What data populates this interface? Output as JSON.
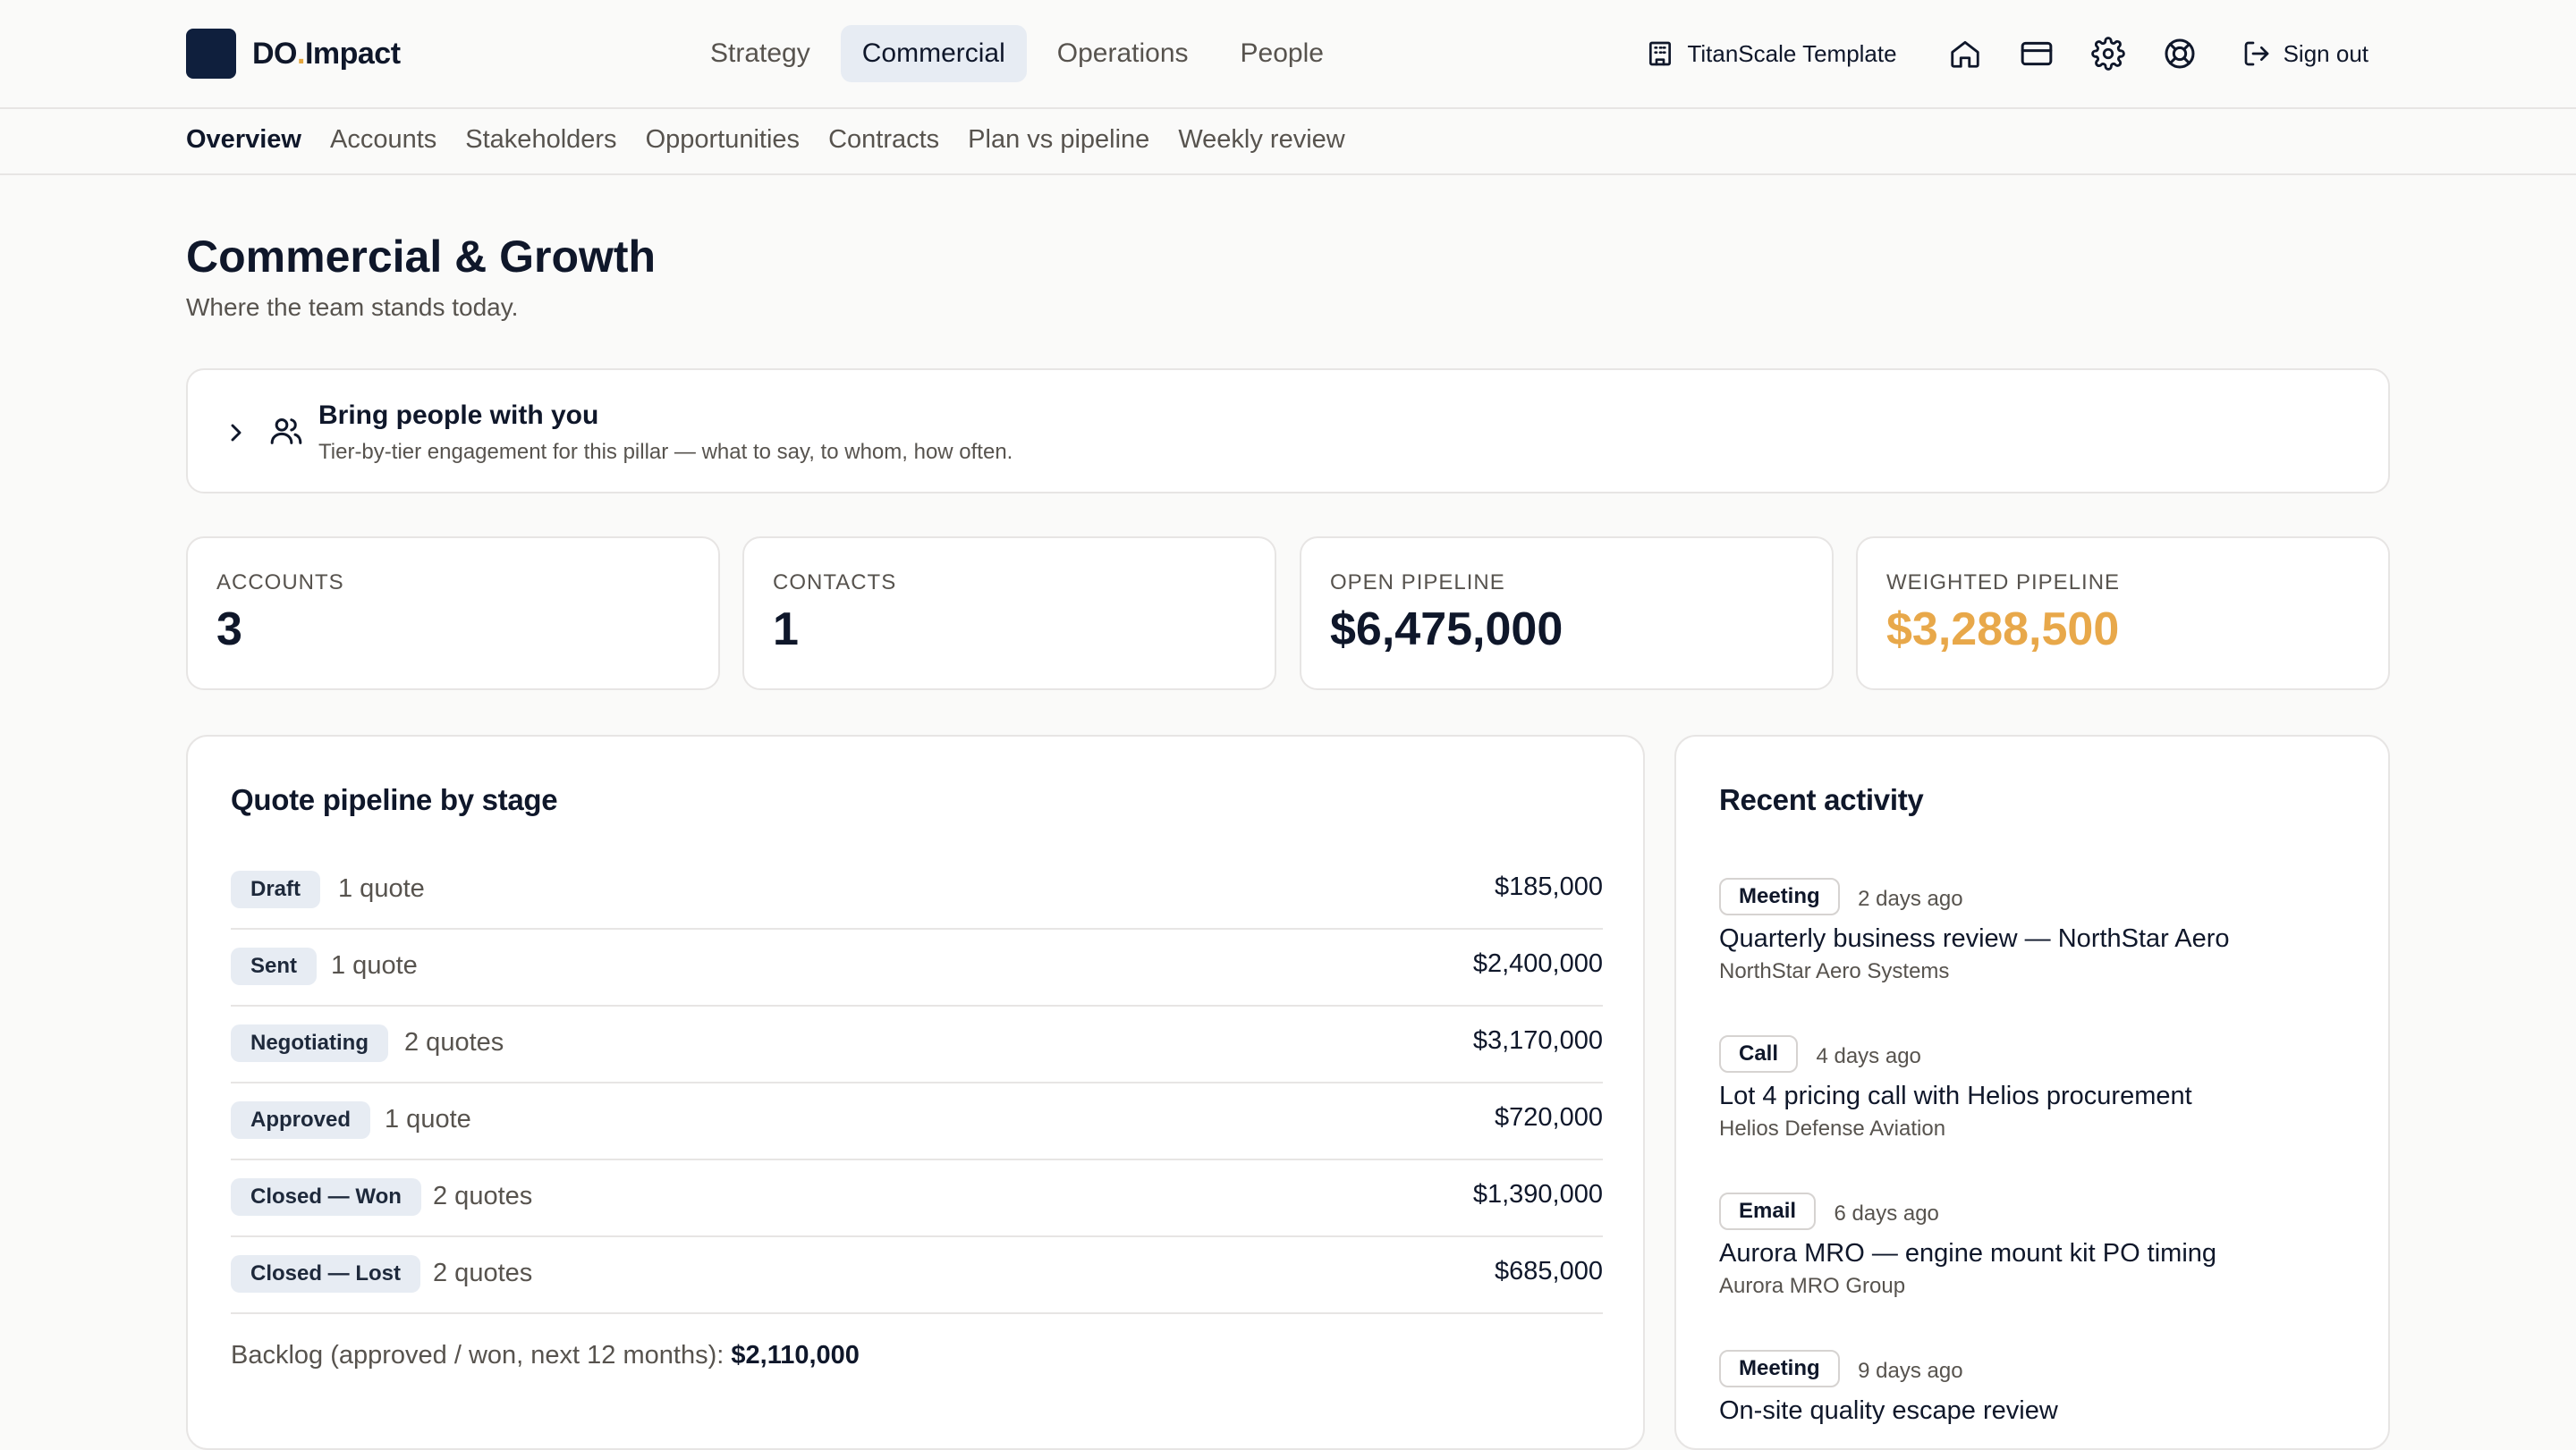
{
  "brand": {
    "name": "DO",
    "dot": ".",
    "suffix": "Impact"
  },
  "topnav": [
    {
      "label": "Strategy"
    },
    {
      "label": "Commercial",
      "active": true
    },
    {
      "label": "Operations"
    },
    {
      "label": "People"
    }
  ],
  "tenant": {
    "label": "TitanScale Template"
  },
  "signout": {
    "label": "Sign out"
  },
  "subnav": [
    {
      "label": "Overview",
      "active": true
    },
    {
      "label": "Accounts"
    },
    {
      "label": "Stakeholders"
    },
    {
      "label": "Opportunities"
    },
    {
      "label": "Contracts"
    },
    {
      "label": "Plan vs pipeline"
    },
    {
      "label": "Weekly review"
    }
  ],
  "page": {
    "title": "Commercial & Growth",
    "subtitle": "Where the team stands today."
  },
  "banner": {
    "title": "Bring people with you",
    "subtitle": "Tier-by-tier engagement for this pillar — what to say, to whom, how often."
  },
  "kpis": [
    {
      "label": "ACCOUNTS",
      "value": "3"
    },
    {
      "label": "CONTACTS",
      "value": "1"
    },
    {
      "label": "OPEN PIPELINE",
      "value": "$6,475,000"
    },
    {
      "label": "WEIGHTED PIPELINE",
      "value": "$3,288,500"
    }
  ],
  "pipeline": {
    "title": "Quote pipeline by stage",
    "stages": [
      {
        "stage": "Draft",
        "count": "1 quote",
        "amount": "$185,000"
      },
      {
        "stage": "Sent",
        "count": "1 quote",
        "amount": "$2,400,000"
      },
      {
        "stage": "Negotiating",
        "count": "2 quotes",
        "amount": "$3,170,000"
      },
      {
        "stage": "Approved",
        "count": "1 quote",
        "amount": "$720,000"
      },
      {
        "stage": "Closed — Won",
        "count": "2 quotes",
        "amount": "$1,390,000"
      },
      {
        "stage": "Closed — Lost",
        "count": "2 quotes",
        "amount": "$685,000"
      }
    ],
    "backlog_label": "Backlog (approved / won, next 12 months):",
    "backlog_value": "$2,110,000"
  },
  "activity": {
    "title": "Recent activity",
    "items": [
      {
        "type": "Meeting",
        "when": "2 days ago",
        "title": "Quarterly business review — NorthStar Aero",
        "org": "NorthStar Aero Systems"
      },
      {
        "type": "Call",
        "when": "4 days ago",
        "title": "Lot 4 pricing call with Helios procurement",
        "org": "Helios Defense Aviation"
      },
      {
        "type": "Email",
        "when": "6 days ago",
        "title": "Aurora MRO — engine mount kit PO timing",
        "org": "Aurora MRO Group"
      },
      {
        "type": "Meeting",
        "when": "9 days ago",
        "title": "On-site quality escape review",
        "org": ""
      }
    ]
  },
  "colors": {
    "accent": "#e8a84a",
    "pill_bg": "#e7ecf3",
    "brand_mark": "#0f1f3d"
  }
}
